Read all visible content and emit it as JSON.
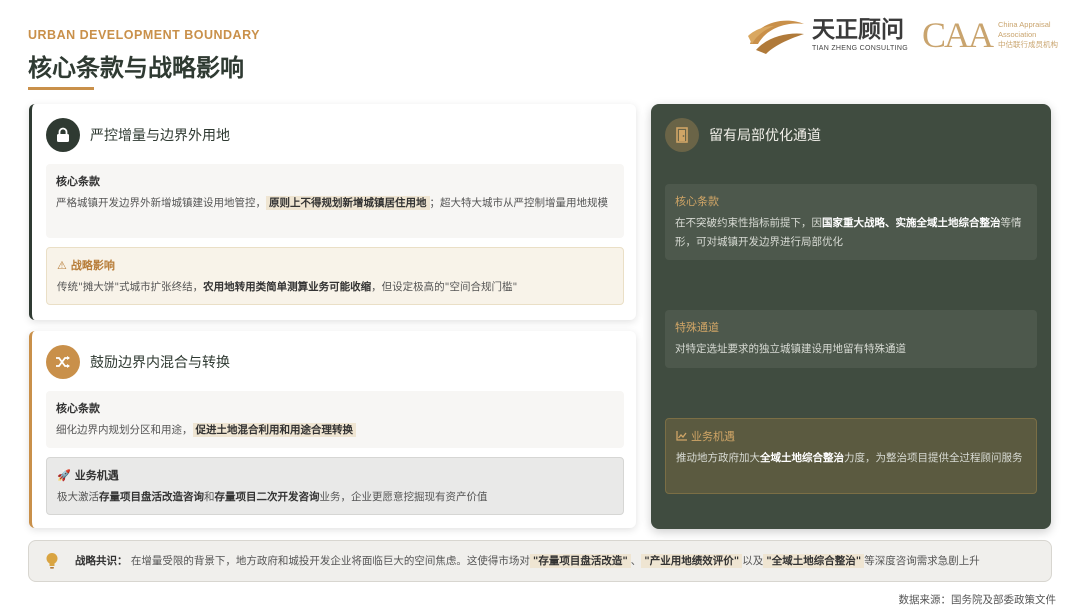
{
  "header": {
    "eyebrow": "URBAN DEVELOPMENT BOUNDARY",
    "title": "核心条款与战略影响"
  },
  "logos": {
    "tianzheng_cn": "天正顾问",
    "tianzheng_en": "TIAN ZHENG CONSULTING",
    "caa_mark": "CAA",
    "caa_line1": "China Appraisal",
    "caa_line2": "Association",
    "caa_line3": "中估联行成员机构"
  },
  "card1": {
    "icon": "lock-icon",
    "title": "严控增量与边界外用地",
    "core": {
      "title": "核心条款",
      "pre": "严格城镇开发边界外新增城镇建设用地管控，",
      "hl": "原则上不得规划新增城镇居住用地",
      "post": "；超大特大城市从严控制增量用地规模"
    },
    "impact": {
      "icon": "warning-icon",
      "title": "战略影响",
      "pre": "传统\"摊大饼\"式城市扩张终结，",
      "bold": "农用地转用类简单测算业务可能收缩",
      "post": "，但设定极高的\"空间合规门槛\""
    }
  },
  "card2": {
    "icon": "shuffle-icon",
    "title": "鼓励边界内混合与转换",
    "core": {
      "title": "核心条款",
      "pre": "细化边界内规划分区和用途，",
      "hl": "促进土地混合利用和用途合理转换"
    },
    "opportunity": {
      "icon": "rocket-icon",
      "title": "业务机遇",
      "pre": "极大激活",
      "bold1": "存量项目盘活改造咨询",
      "mid": "和",
      "bold2": "存量项目二次开发咨询",
      "post": "业务，企业更愿意挖掘现有资产价值"
    }
  },
  "panel": {
    "icon": "door-icon",
    "title": "留有局部优化通道",
    "core": {
      "title": "核心条款",
      "pre": "在不突破约束性指标前提下，因",
      "bold": "国家重大战略、实施全域土地综合整治",
      "post": "等情形，可对城镇开发边界进行局部优化"
    },
    "special": {
      "title": "特殊通道",
      "body": "对特定选址要求的独立城镇建设用地留有特殊通道"
    },
    "opportunity": {
      "icon": "chart-line-icon",
      "title": "业务机遇",
      "pre": "推动地方政府加大",
      "bold": "全域土地综合整治",
      "post": "力度，为整治项目提供全过程顾问服务"
    }
  },
  "consensus": {
    "icon": "lightbulb-icon",
    "label": "战略共识：",
    "pre": "在增量受限的背景下，地方政府和城投开发企业将面临巨大的空间焦虑。这使得市场对",
    "hl1": "\"存量项目盘活改造\"",
    "sep1": "、",
    "hl2": "\"产业用地绩效评价\"",
    "sep2": "以及",
    "hl3": "\"全域土地综合整治\"",
    "post": "等深度咨询需求急剧上升"
  },
  "source": "数据来源：国务院及部委政策文件",
  "colors": {
    "accent_gold": "#c9904a",
    "dark_green": "#2f3a32",
    "panel_green": "#404c40"
  }
}
